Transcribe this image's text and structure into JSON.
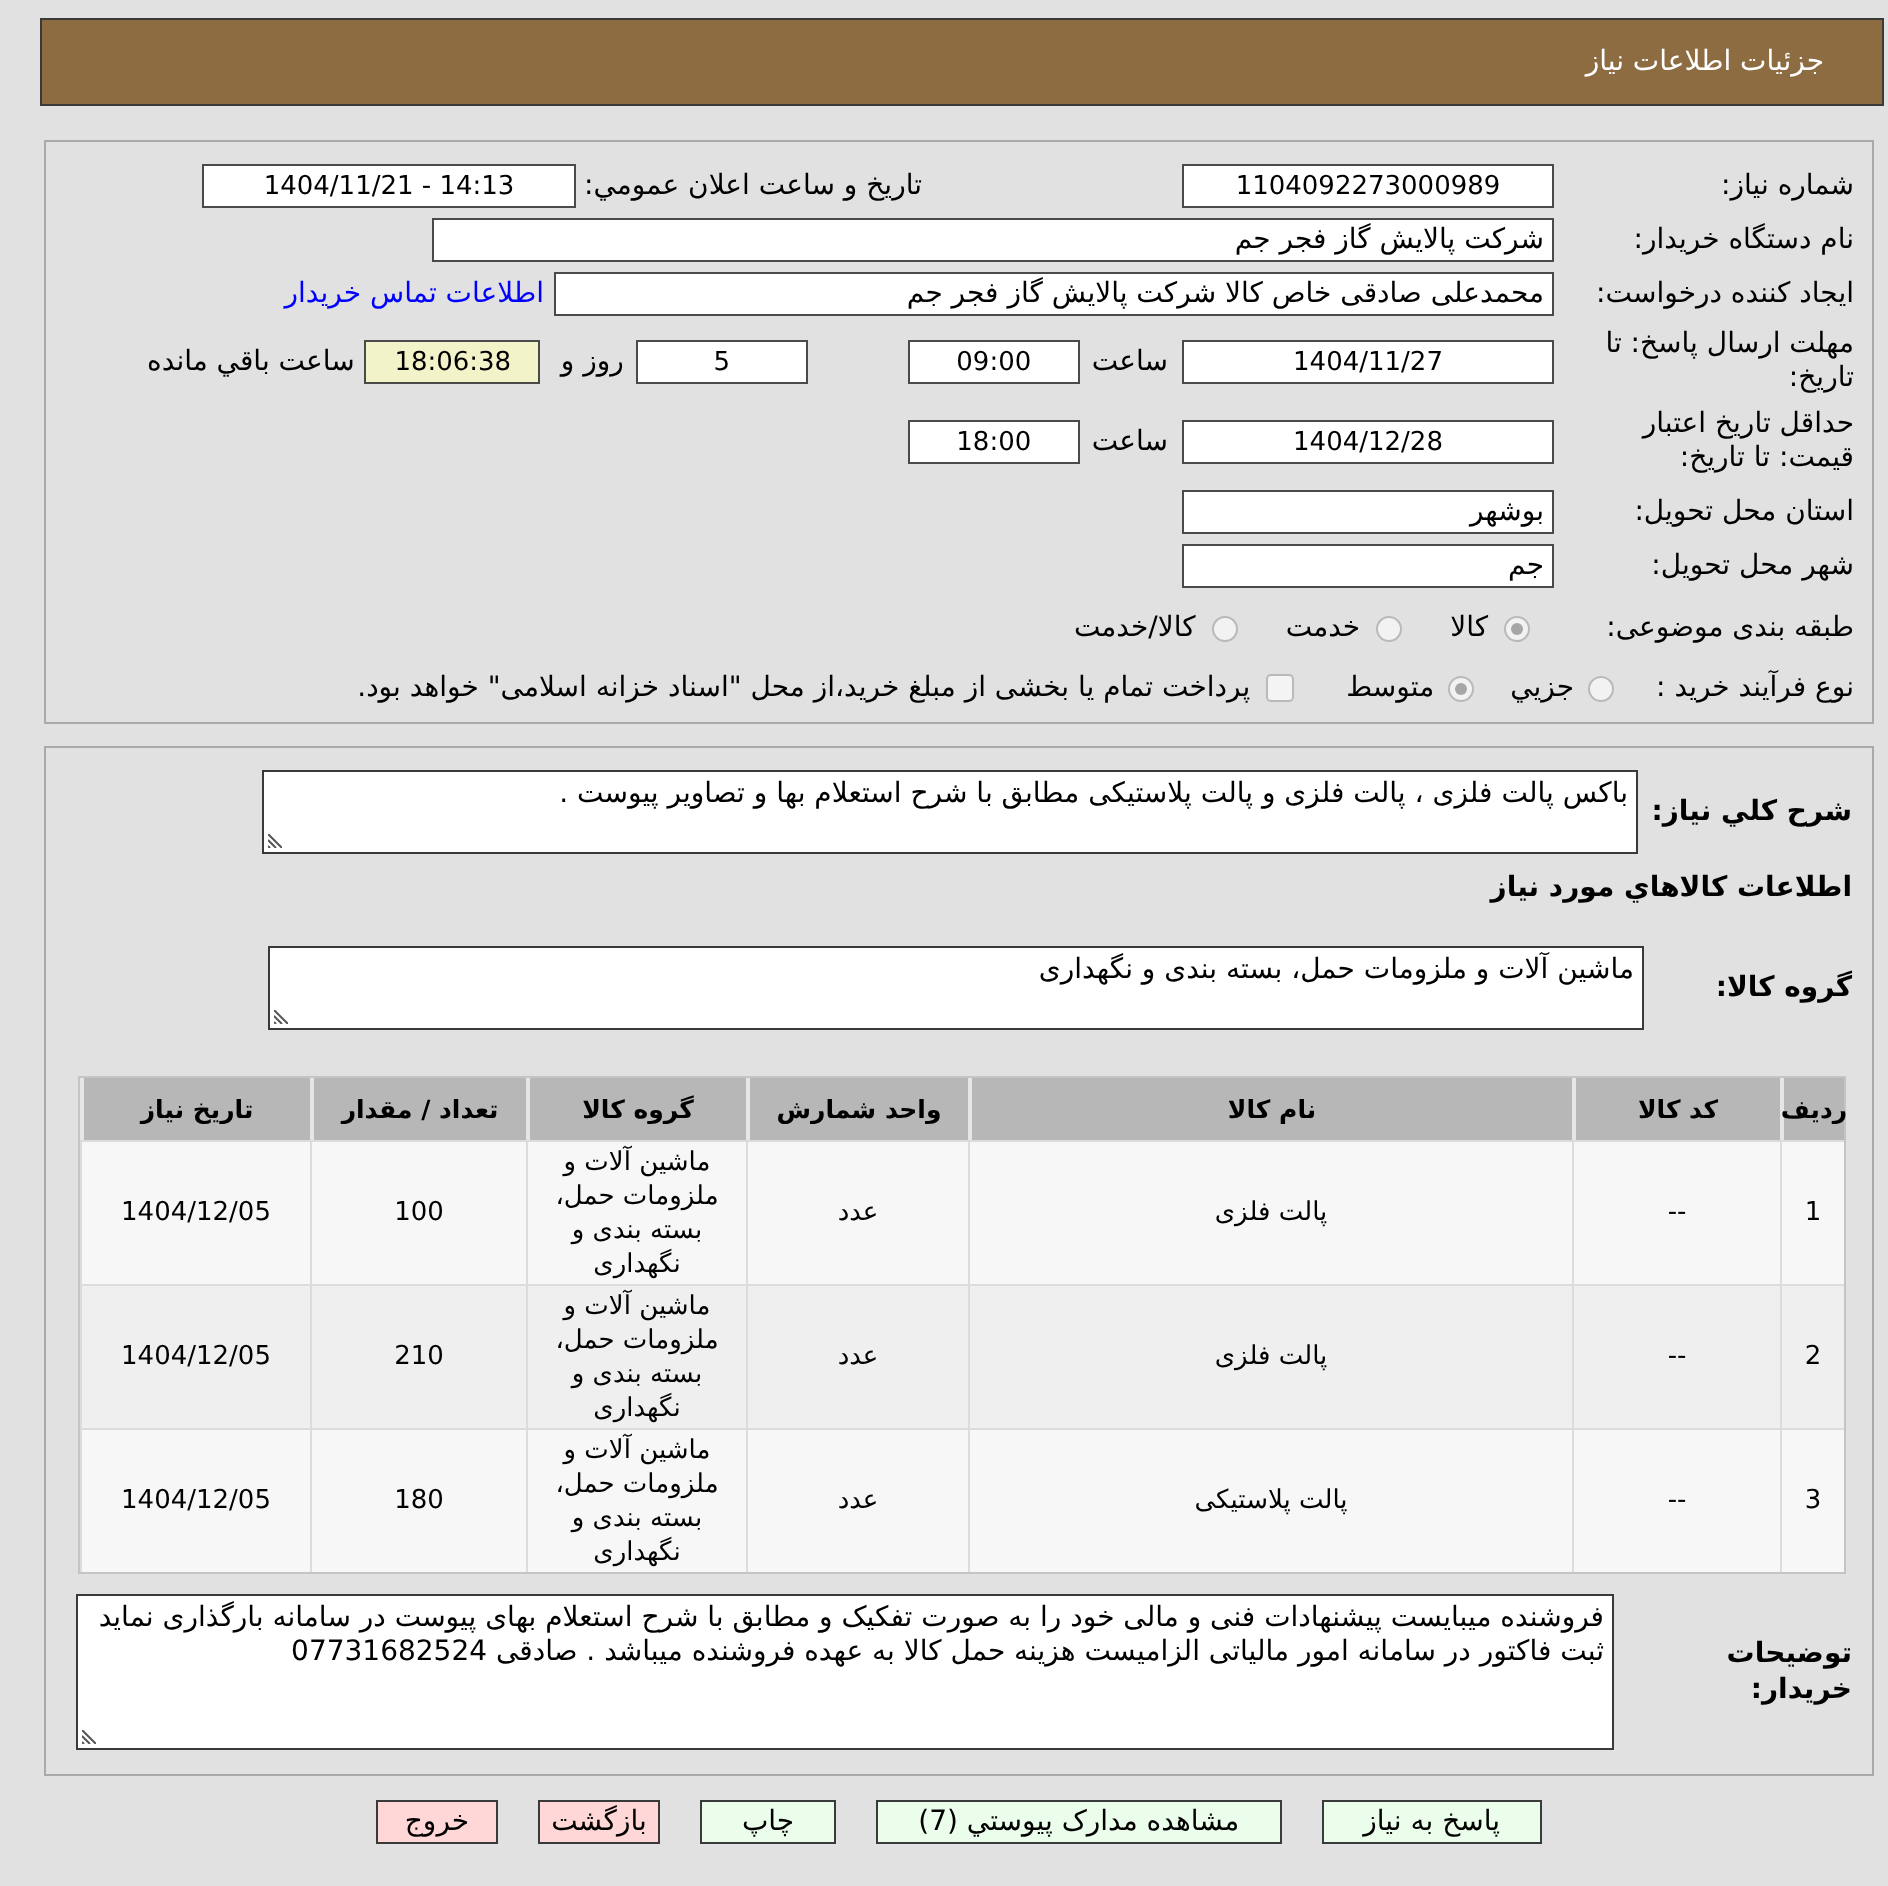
{
  "header": {
    "title": "جزئیات اطلاعات نیاز"
  },
  "details": {
    "need_number": {
      "label": "شماره نیاز:",
      "value": "1104092273000989"
    },
    "announced": {
      "label": "تاریخ و ساعت اعلان عمومي:",
      "value": "1404/11/21 - 14:13"
    },
    "buyer": {
      "label": "نام دستگاه خریدار:",
      "value": "شرکت پالایش گاز فجر جم"
    },
    "requester": {
      "label": "ایجاد کننده درخواست:",
      "value": "محمدعلی صادقی خاص کالا شرکت پالایش گاز فجر جم",
      "contact_link": "اطلاعات تماس خریدار"
    },
    "reply_deadline": {
      "label": "مهلت ارسال پاسخ: تا تاریخ:",
      "date": "1404/11/27",
      "time_label": "ساعت",
      "time": "09:00",
      "days": "5",
      "days_label": "روز و",
      "remaining": "18:06:38",
      "remaining_label": "ساعت باقي مانده"
    },
    "price_validity": {
      "label": "حداقل تاریخ اعتبار قیمت: تا تاریخ:",
      "date": "1404/12/28",
      "time_label": "ساعت",
      "time": "18:00"
    },
    "province": {
      "label": "استان محل تحویل:",
      "value": "بوشهر"
    },
    "city": {
      "label": "شهر محل تحویل:",
      "value": "جم"
    },
    "category": {
      "label": "طبقه بندی موضوعی:",
      "options": [
        {
          "label": "کالا",
          "selected": true,
          "disabled": true
        },
        {
          "label": "خدمت",
          "selected": false,
          "disabled": true
        },
        {
          "label": "کالا/خدمت",
          "selected": false,
          "disabled": true
        }
      ]
    },
    "process": {
      "label": "نوع فرآیند خرید :",
      "options": [
        {
          "label": "جزيي",
          "selected": false,
          "disabled": true
        },
        {
          "label": "متوسط",
          "selected": true,
          "disabled": true
        }
      ],
      "treasury_payment": {
        "label": "پرداخت تمام یا بخشی از مبلغ خرید،از محل \"اسناد خزانه اسلامی\" خواهد بود.",
        "checked": false,
        "disabled": true
      }
    }
  },
  "items": {
    "description": {
      "label": "شرح کلي نیاز:",
      "value": "باکس پالت فلزی ، پالت فلزی و پالت پلاستیکی مطابق با شرح استعلام بها و تصاویر پیوست ."
    },
    "heading": "اطلاعات کالاهاي مورد نیاز",
    "goods_group": {
      "label": "گروه کالا:",
      "value": "ماشین آلات و ملزومات حمل، بسته بندی و نگهداری"
    },
    "table": {
      "columns": [
        "ردیف",
        "کد کالا",
        "نام کالا",
        "واحد شمارش",
        "گروه کالا",
        "تعداد / مقدار",
        "تاریخ نیاز"
      ],
      "rows": [
        [
          "1",
          "--",
          "پالت فلزی",
          "عدد",
          "ماشین آلات و ملزومات حمل، بسته بندی و نگهداری",
          "100",
          "1404/12/05"
        ],
        [
          "2",
          "--",
          "پالت فلزی",
          "عدد",
          "ماشین آلات و ملزومات حمل، بسته بندی و نگهداری",
          "210",
          "1404/12/05"
        ],
        [
          "3",
          "--",
          "پالت پلاستیکی",
          "عدد",
          "ماشین آلات و ملزومات حمل، بسته بندی و نگهداری",
          "180",
          "1404/12/05"
        ]
      ]
    },
    "buyer_notes": {
      "label": "توضیحات خریدار:",
      "value": "فروشنده میبایست پیشنهادات فنی و مالی خود را به صورت تفکیک و مطابق با شرح استعلام بهای پیوست در سامانه بارگذاری نماید ثبت فاکتور در سامانه امور مالیاتی الزامیست هزینه حمل کالا به عهده فروشنده میباشد . صادقی 07731682524"
    }
  },
  "buttons": [
    {
      "label": "پاسخ به نیاز",
      "kind": "positive"
    },
    {
      "label": "مشاهده مدارک پیوستي (7)",
      "kind": "positive"
    },
    {
      "label": "چاپ",
      "kind": "positive"
    },
    {
      "label": "بازگشت",
      "kind": "negative"
    },
    {
      "label": "خروج",
      "kind": "negative"
    }
  ]
}
